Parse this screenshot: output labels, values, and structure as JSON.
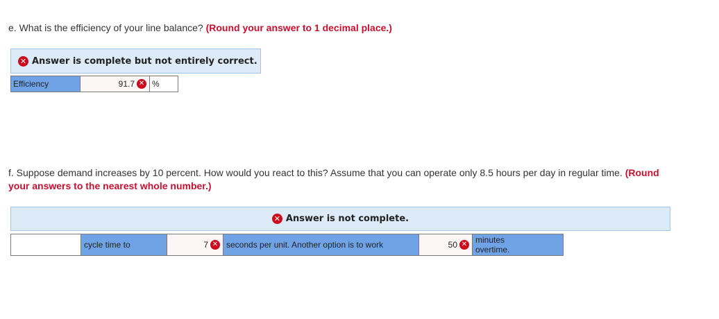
{
  "question_e": {
    "text": "e. What is the efficiency of your line balance? ",
    "hint": "(Round your answer to 1 decimal place.)"
  },
  "answer_e": {
    "banner": "Answer is complete but not entirely correct.",
    "label": "Efficiency",
    "value": "91.7",
    "unit": "%"
  },
  "question_f": {
    "text": "f. Suppose demand increases by 10 percent. How would you react to this? Assume that you can operate only 8.5 hours per day in regular time. ",
    "hint": "(Round your answers to the nearest whole number.)"
  },
  "answer_f": {
    "banner": "Answer is not complete.",
    "blank": "",
    "label_1": "cycle time to",
    "value_1": "7",
    "label_2": "seconds per unit. Another option is to work",
    "value_2": "50",
    "label_3": "minutes overtime."
  },
  "icons": {
    "incorrect": "x-circle-icon"
  },
  "colors": {
    "hint": "#c8102e",
    "banner_bg": "#dcebf7",
    "label_bg": "#6fa3e5",
    "error_icon": "#cc0a1b"
  }
}
